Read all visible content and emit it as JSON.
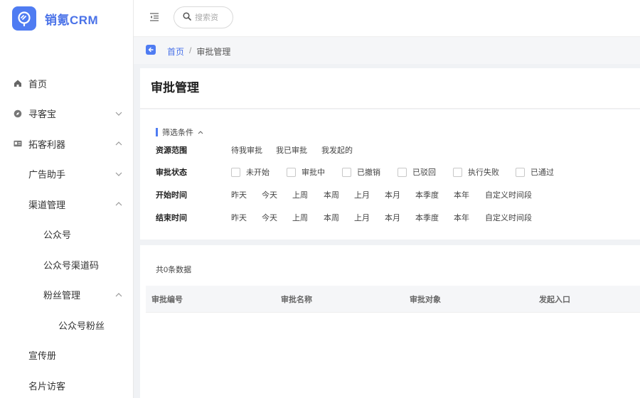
{
  "brand": {
    "name": "销氪CRM",
    "accent": "#4f7cf2"
  },
  "header": {
    "search_placeholder": "搜索资"
  },
  "breadcrumb": {
    "home": "首页",
    "separator": "/",
    "current": "审批管理"
  },
  "sidebar": {
    "items": [
      {
        "label": "首页",
        "icon": "home-icon",
        "level": 1
      },
      {
        "label": "寻客宝",
        "icon": "compass-icon",
        "level": 1,
        "chevron": "down"
      },
      {
        "label": "拓客利器",
        "icon": "card-icon",
        "level": 1,
        "chevron": "up"
      },
      {
        "label": "广告助手",
        "level": 2,
        "chevron": "down"
      },
      {
        "label": "渠道管理",
        "level": 2,
        "chevron": "up"
      },
      {
        "label": "公众号",
        "level": 3
      },
      {
        "label": "公众号渠道码",
        "level": 3
      },
      {
        "label": "粉丝管理",
        "level": 3,
        "chevron": "up"
      },
      {
        "label": "公众号粉丝",
        "level": 4
      },
      {
        "label": "宣传册",
        "level": 2
      },
      {
        "label": "名片访客",
        "level": 2
      }
    ]
  },
  "page": {
    "title": "审批管理"
  },
  "filter": {
    "heading": "筛选条件",
    "rows": {
      "scope": {
        "label": "资源范围",
        "options": [
          "待我审批",
          "我已审批",
          "我发起的"
        ]
      },
      "status": {
        "label": "审批状态",
        "options": [
          "未开始",
          "审批中",
          "已撤销",
          "已驳回",
          "执行失败",
          "已通过"
        ]
      },
      "start": {
        "label": "开始时间",
        "options": [
          "昨天",
          "今天",
          "上周",
          "本周",
          "上月",
          "本月",
          "本季度",
          "本年",
          "自定义时间段"
        ]
      },
      "end": {
        "label": "结束时间",
        "options": [
          "昨天",
          "今天",
          "上周",
          "本周",
          "上月",
          "本月",
          "本季度",
          "本年",
          "自定义时间段"
        ]
      }
    }
  },
  "table": {
    "count_text": "共0条数据",
    "columns": [
      "审批编号",
      "审批名称",
      "审批对象",
      "发起入口"
    ]
  }
}
